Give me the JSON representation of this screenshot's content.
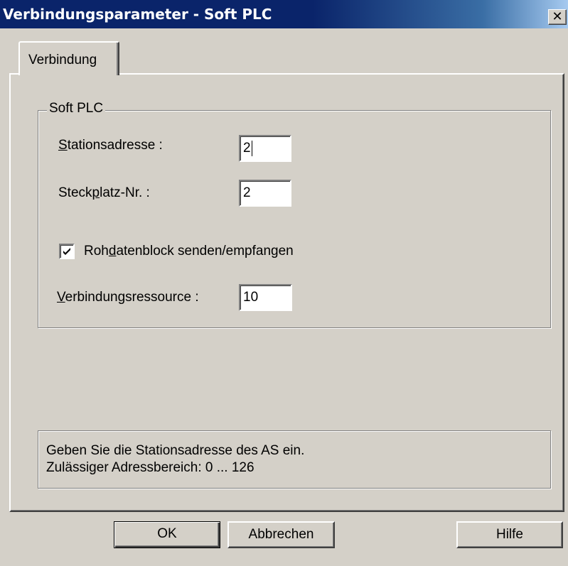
{
  "window": {
    "title": "Verbindungsparameter - Soft PLC",
    "close_glyph": "✕"
  },
  "tabs": [
    {
      "label": "Verbindung"
    }
  ],
  "group": {
    "legend": "Soft PLC",
    "stationsadresse_label": {
      "u": "S",
      "rest": "tationsadresse :"
    },
    "stationsadresse_value": "2",
    "steckplatz_label": {
      "pre": "Steck",
      "u": "p",
      "rest": "latz-Nr. :"
    },
    "steckplatz_value": "2",
    "checkbox_label": {
      "pre": "Roh",
      "u": "d",
      "rest": "atenblock senden/empfangen"
    },
    "checkbox_checked": true,
    "ressource_label": {
      "u": "V",
      "rest": "erbindungsressource :"
    },
    "ressource_value": "10"
  },
  "hint": {
    "line1": "Geben Sie die Stationsadresse des AS ein.",
    "line2": "Zulässiger Adressbereich: 0 ... 126"
  },
  "buttons": {
    "ok": "OK",
    "cancel": "Abbrechen",
    "help": "Hilfe"
  },
  "colors": {
    "face": "#d4d0c8",
    "title_bar": "#0a246a",
    "title_text": "#ffffff"
  },
  "icons": {
    "close": "close-icon",
    "check": "checkmark-icon"
  }
}
